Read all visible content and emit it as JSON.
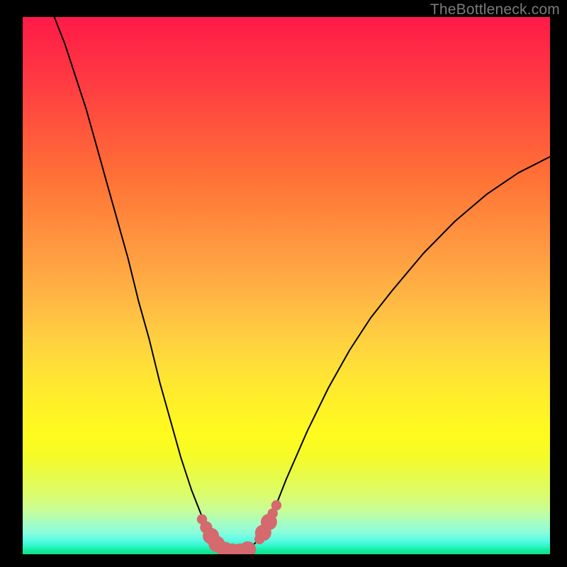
{
  "watermark": "TheBottleneck.com",
  "colors": {
    "background": "#000000",
    "curve": "#000000",
    "beads": "#d46a6d"
  },
  "chart_data": {
    "type": "line",
    "title": "",
    "xlabel": "",
    "ylabel": "",
    "xlim": [
      0,
      100
    ],
    "ylim": [
      0,
      100
    ],
    "series": [
      {
        "name": "bottleneck-curve",
        "x": [
          6,
          8,
          10,
          12,
          14,
          16,
          18,
          20,
          22,
          24,
          26,
          28,
          30,
          32,
          34,
          35,
          36,
          37,
          38,
          39,
          40,
          41,
          42,
          43,
          44,
          45,
          46,
          48,
          50,
          54,
          58,
          62,
          66,
          70,
          76,
          82,
          88,
          94,
          100
        ],
        "y": [
          100,
          95,
          89,
          83,
          76,
          69,
          62,
          55,
          47,
          40,
          32,
          25,
          18,
          12,
          7,
          5,
          3,
          2,
          1,
          0.5,
          0.5,
          0.5,
          0.5,
          1,
          2,
          3,
          5,
          9,
          14,
          23,
          31,
          38,
          44,
          49,
          56,
          62,
          67,
          71,
          74
        ]
      }
    ],
    "markers": [
      {
        "x": 34.0,
        "y": 6.5,
        "r": 1.0
      },
      {
        "x": 34.8,
        "y": 5.0,
        "r": 1.2
      },
      {
        "x": 35.7,
        "y": 3.4,
        "r": 1.6
      },
      {
        "x": 36.8,
        "y": 1.9,
        "r": 1.6
      },
      {
        "x": 38.3,
        "y": 0.8,
        "r": 1.6
      },
      {
        "x": 39.8,
        "y": 0.5,
        "r": 1.6
      },
      {
        "x": 41.3,
        "y": 0.5,
        "r": 1.6
      },
      {
        "x": 42.7,
        "y": 0.9,
        "r": 1.6
      },
      {
        "x": 44.9,
        "y": 2.8,
        "r": 1.0
      },
      {
        "x": 45.6,
        "y": 4.0,
        "r": 1.6
      },
      {
        "x": 46.7,
        "y": 6.0,
        "r": 1.6
      },
      {
        "x": 47.4,
        "y": 7.6,
        "r": 1.0
      },
      {
        "x": 48.1,
        "y": 9.1,
        "r": 1.0
      }
    ]
  }
}
